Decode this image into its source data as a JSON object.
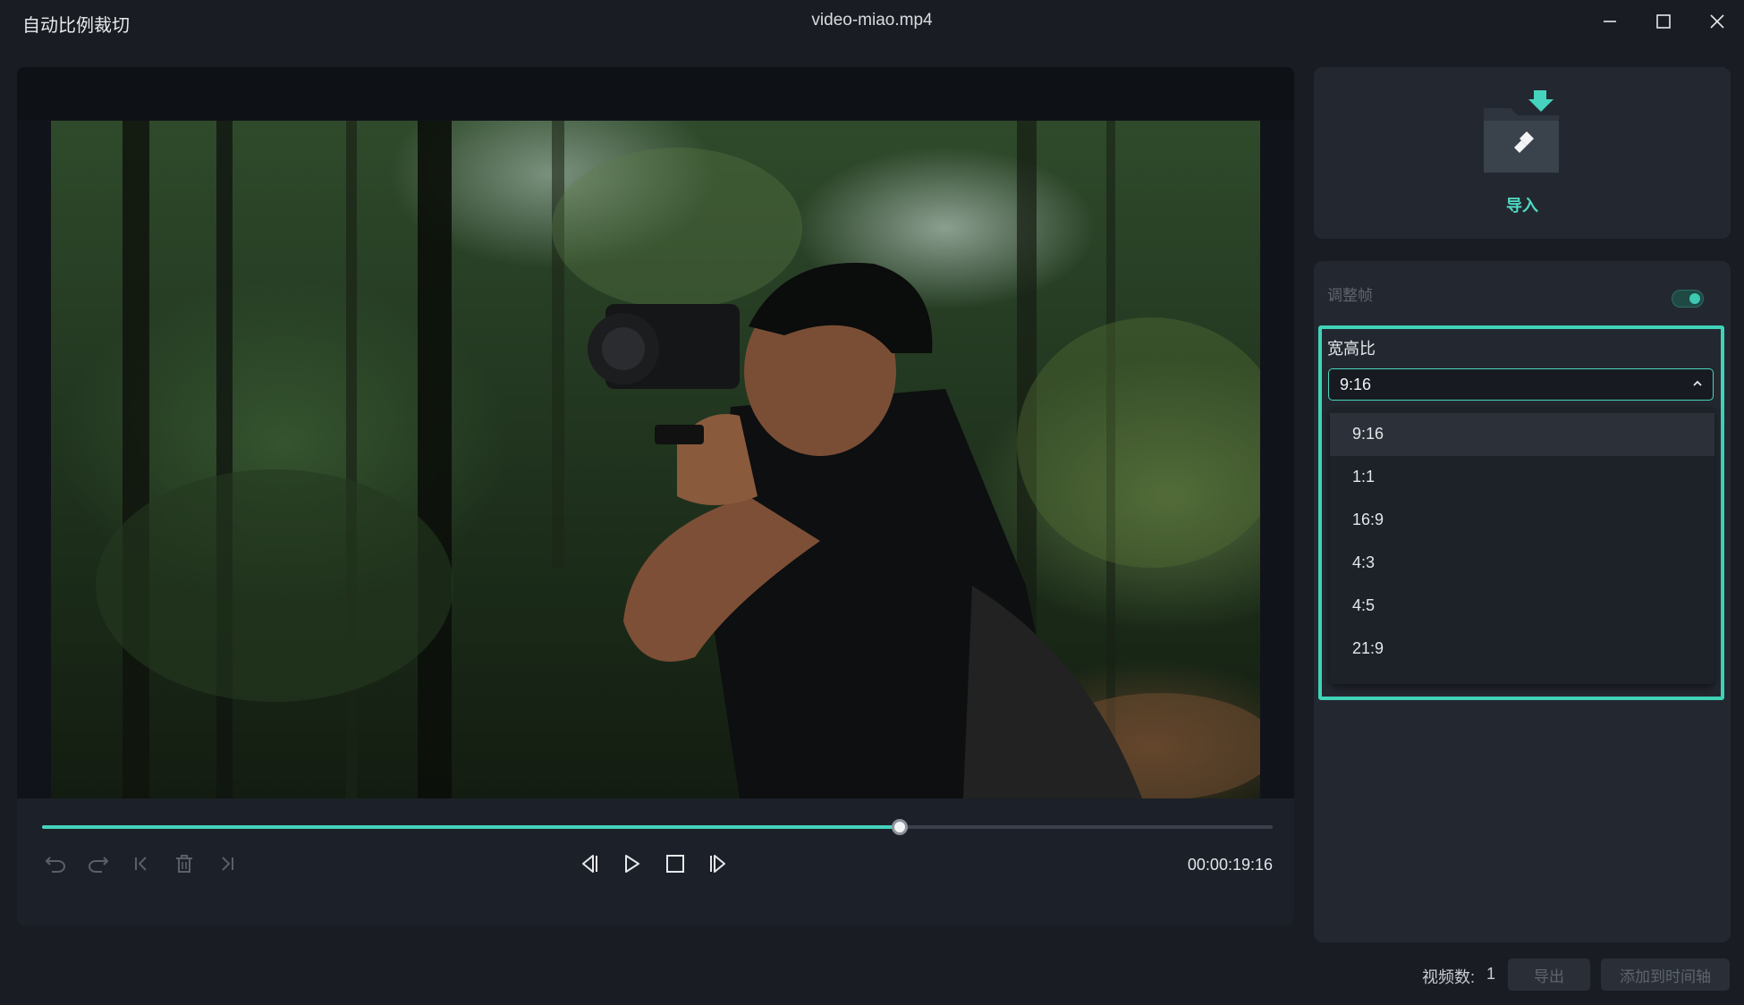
{
  "window": {
    "app_title": "自动比例裁切",
    "file_name": "video-miao.mp4",
    "controls": [
      "minimize-icon",
      "maximize-icon",
      "close-icon"
    ]
  },
  "player": {
    "progress": 0.697,
    "timecode": "00:00:19:16",
    "left_tools": [
      "undo-icon",
      "redo-icon",
      "jump-to-start-icon",
      "delete-icon",
      "jump-to-end-icon"
    ],
    "center_tools": [
      "previous-frame-icon",
      "play-icon",
      "stop-icon",
      "next-frame-icon"
    ]
  },
  "import": {
    "label": "导入",
    "icon": "import-folder-icon"
  },
  "settings": {
    "adjust_frame_label": "调整帧",
    "adjust_frame_enabled": true,
    "aspect_ratio_label": "宽高比",
    "aspect_ratio_selected": "9:16",
    "aspect_ratio_options": [
      "9:16",
      "1:1",
      "16:9",
      "4:3",
      "4:5",
      "21:9"
    ]
  },
  "footer": {
    "video_count_label": "视频数:",
    "video_count_value": "1",
    "export_label": "导出",
    "add_to_timeline_label": "添加到时间轴"
  },
  "colors": {
    "accent": "#45d3bd",
    "background": "#191d23",
    "panel": "#232830"
  }
}
